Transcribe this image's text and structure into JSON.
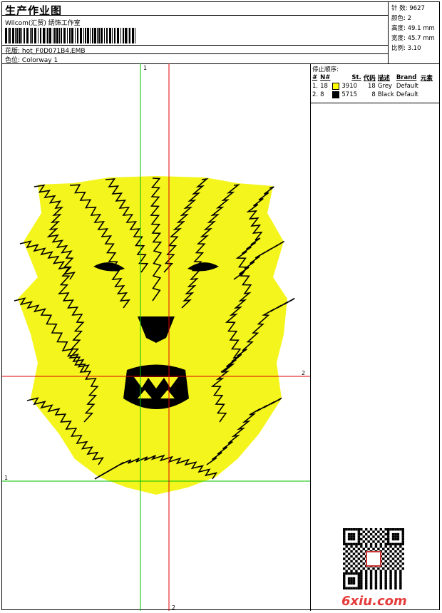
{
  "header": {
    "title": "生产作业图",
    "company": "Wilcom(汇贸) 绣饰工作室",
    "design_label": "花版:",
    "design_value": "hot_F0D071B4.EMB",
    "colorway_label": "色位:",
    "colorway_value": "Colorway 1"
  },
  "stats": {
    "stitches": "针 数: 9627",
    "colors": "颜色: 2",
    "height": "高度: 49.1 mm",
    "width": "宽度: 45.7 mm",
    "scale": "比例: 3.10"
  },
  "stop_sequence": {
    "caption": "停止顺序:",
    "headers": [
      "#",
      "N#",
      "",
      "St.",
      "代码",
      "描述",
      "Brand",
      "元素"
    ],
    "rows": [
      {
        "idx": "1.",
        "n": "18",
        "color": "#ffff00",
        "code": "3910",
        "st": "18",
        "desc": "Grey",
        "brand": "Default"
      },
      {
        "idx": "2.",
        "n": "8",
        "color": "#000000",
        "code": "5715",
        "st": "8",
        "desc": "Black",
        "brand": "Default"
      }
    ]
  },
  "canvas": {
    "guide_labels": {
      "green_top": "1",
      "green_left": "1",
      "red_right": "2",
      "red_bottom": "2"
    },
    "colors": {
      "fill": "#f5f51e",
      "stroke": "#000000",
      "guide_green": "#00c000",
      "guide_red": "#e00000"
    }
  },
  "watermark": {
    "text": "6xiu.com"
  }
}
